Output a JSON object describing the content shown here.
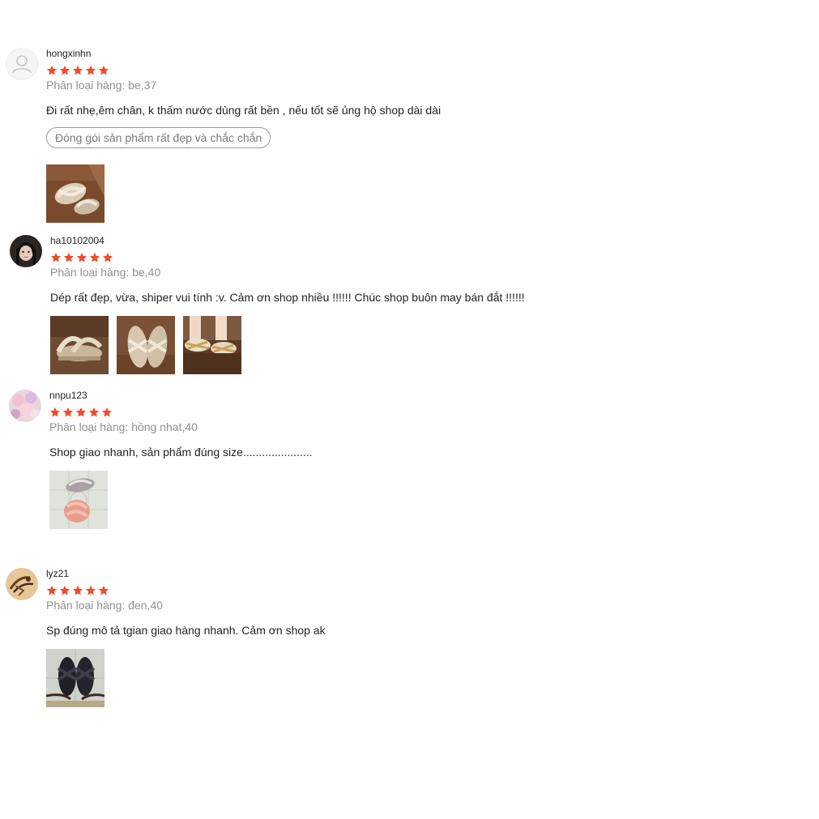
{
  "colors": {
    "star": "#ee4d2d",
    "text": "#222222",
    "muted": "#8f8f8f",
    "tag_border": "#9a9a9a"
  },
  "icons": {
    "star": "star-icon",
    "default_avatar": "user-icon"
  },
  "reviews": [
    {
      "username": "hongxinhn",
      "rating": 5,
      "variation": "Phân loại hàng: be,37",
      "comment": "Đi rất nhẹ,êm chân, k thấm nước dùng rất bền , nếu tốt sẽ ủng hộ shop dài dài",
      "tag": "Đóng gói sản phẩm rất đẹp và chắc chắn",
      "photos": [
        "beige strap sandals on brown floor"
      ]
    },
    {
      "username": "ha10102004",
      "rating": 5,
      "variation": "Phân loại hàng: be,40",
      "comment": "Dép rất đẹp, vừa, shiper vui tính :v. Cảm ơn shop nhiều !!!!!! Chúc shop buôn may bán đắt !!!!!!",
      "photos": [
        "beige sandal side view",
        "beige sandals top view",
        "sandals being worn"
      ]
    },
    {
      "username": "nnpu123",
      "rating": 5,
      "variation": "Phân loại hàng: hồng nhat,40",
      "comment": "Shop giao nhanh, sản phẩm đúng size......................",
      "photos": [
        "pink sandals on tiled floor"
      ]
    },
    {
      "username": "lyz21",
      "rating": 5,
      "variation": "Phân loại hàng: đen,40",
      "comment": "Sp đúng mô tả tgian giao hàng nhanh. Cảm ơn shop ak",
      "photos": [
        "black sandals on tiled floor"
      ]
    }
  ]
}
